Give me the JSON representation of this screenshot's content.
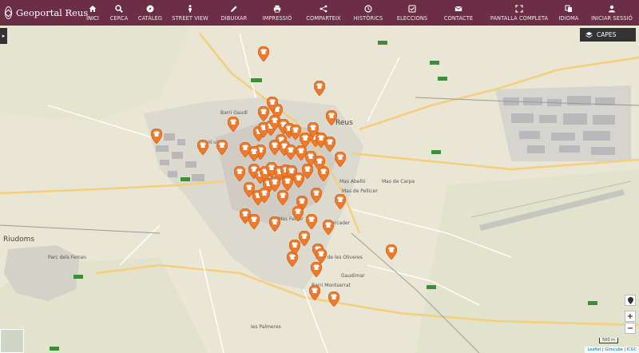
{
  "header": {
    "brand": "Geoportal Reus",
    "colors": {
      "bar": "#6b2e44",
      "marker": "#ef7a2c"
    },
    "nav": [
      {
        "key": "inici",
        "label": "INICI",
        "icon": "home-icon"
      },
      {
        "key": "cerca",
        "label": "CERCA",
        "icon": "search-icon"
      },
      {
        "key": "cataleg",
        "label": "CATÀLEG",
        "icon": "compass-icon"
      },
      {
        "key": "streetview",
        "label": "STREET VIEW",
        "icon": "pegman-icon"
      },
      {
        "key": "dibuixar",
        "label": "DIBUIXAR",
        "icon": "pencil-icon"
      },
      {
        "key": "impressio",
        "label": "IMPRESSIÓ",
        "icon": "print-icon"
      },
      {
        "key": "comparteix",
        "label": "COMPARTEIX",
        "icon": "share-icon"
      },
      {
        "key": "historics",
        "label": "HISTÒRICS",
        "icon": "clock-icon"
      },
      {
        "key": "eleccions",
        "label": "ELECCIONS",
        "icon": "ballot-icon"
      },
      {
        "key": "contacte",
        "label": "CONTACTE",
        "icon": "mail-icon"
      }
    ],
    "nav_right": [
      {
        "key": "fullscreen",
        "label": "PANTALLA COMPLETA",
        "icon": "fullscreen-icon"
      },
      {
        "key": "idioma",
        "label": "IDIOMA",
        "icon": "translate-icon"
      },
      {
        "key": "login",
        "label": "INICIAR SESSIÓ",
        "icon": "user-icon"
      }
    ]
  },
  "map": {
    "layers_label": "CAPES",
    "zoom_in": "+",
    "zoom_out": "−",
    "scale": "500 m",
    "attribution": {
      "leaflet": "Leaflet",
      "sep1": " | ",
      "geo": "Girocube",
      "sep2": " | ",
      "icgc": "ICGC"
    },
    "places": [
      {
        "id": "riudoms",
        "label": "Riudoms"
      },
      {
        "id": "parcdelsferran",
        "label": "Parc dels Ferran"
      },
      {
        "id": "maspellicer",
        "label": "Mas de Pellicer"
      },
      {
        "id": "masdecarpa",
        "label": "Mas de Carpa"
      },
      {
        "id": "masferrer",
        "label": "Mas Ferrer"
      },
      {
        "id": "mercader",
        "label": "Mercader"
      },
      {
        "id": "masabello",
        "label": "Mas Abelló"
      },
      {
        "id": "parcdelsillers",
        "label": "Parc de les Oliveres"
      },
      {
        "id": "barrigaudi",
        "label": "Barri Gaudí"
      },
      {
        "id": "santvista",
        "label": "Sant-vista"
      },
      {
        "id": "gaudimar",
        "label": "Gaudimar"
      },
      {
        "id": "barrimontserrat",
        "label": "Barri Montserrat"
      },
      {
        "id": "lespalmeres",
        "label": "les Palmeres"
      },
      {
        "id": "reus",
        "label": "Reus"
      }
    ]
  }
}
